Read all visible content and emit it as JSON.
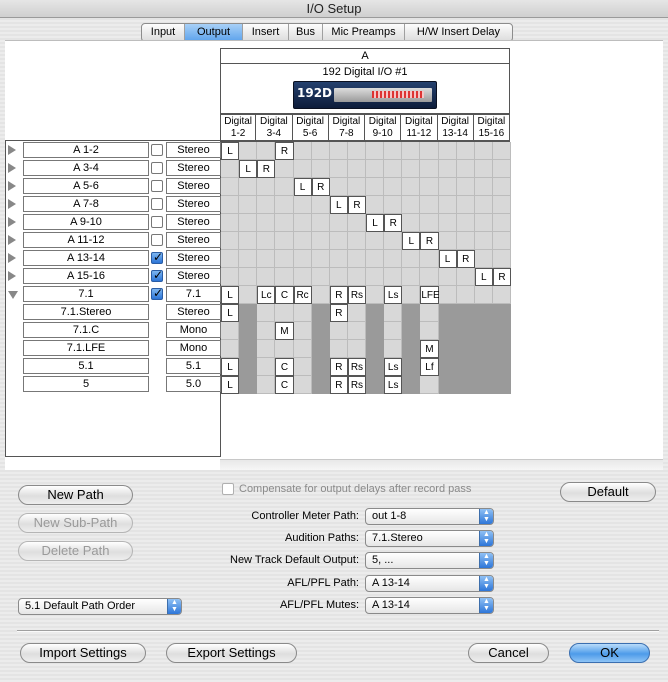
{
  "window": {
    "title": "I/O Setup"
  },
  "tabs": [
    {
      "label": "Input",
      "active": false
    },
    {
      "label": "Output",
      "active": true
    },
    {
      "label": "Insert",
      "active": false
    },
    {
      "label": "Bus",
      "active": false
    },
    {
      "label": "Mic Preamps",
      "active": false
    },
    {
      "label": "H/W Insert Delay",
      "active": false
    }
  ],
  "matrix": {
    "group": "A",
    "device": "192 Digital I/O #1",
    "device_logo": "192D",
    "columns": [
      {
        "top": "Digital",
        "bottom": "1-2"
      },
      {
        "top": "Digital",
        "bottom": "3-4"
      },
      {
        "top": "Digital",
        "bottom": "5-6"
      },
      {
        "top": "Digital",
        "bottom": "7-8"
      },
      {
        "top": "Digital",
        "bottom": "9-10"
      },
      {
        "top": "Digital",
        "bottom": "11-12"
      },
      {
        "top": "Digital",
        "bottom": "13-14"
      },
      {
        "top": "Digital",
        "bottom": "15-16"
      }
    ]
  },
  "paths": [
    {
      "name": "A 1-2",
      "expand": "right",
      "checked": false,
      "format": "Stereo",
      "marks": {
        "0": "L",
        "3": "R"
      }
    },
    {
      "name": "A 3-4",
      "expand": "right",
      "checked": false,
      "format": "Stereo",
      "marks": {
        "1": "L",
        "2": "R"
      }
    },
    {
      "name": "A 5-6",
      "expand": "right",
      "checked": false,
      "format": "Stereo",
      "marks": {
        "4": "L",
        "5": "R"
      }
    },
    {
      "name": "A 7-8",
      "expand": "right",
      "checked": false,
      "format": "Stereo",
      "marks": {
        "6": "L",
        "7": "R"
      }
    },
    {
      "name": "A 9-10",
      "expand": "right",
      "checked": false,
      "format": "Stereo",
      "marks": {
        "8": "L",
        "9": "R"
      }
    },
    {
      "name": "A 11-12",
      "expand": "right",
      "checked": false,
      "format": "Stereo",
      "marks": {
        "10": "L",
        "11": "R"
      }
    },
    {
      "name": "A 13-14",
      "expand": "right",
      "checked": true,
      "format": "Stereo",
      "marks": {
        "12": "L",
        "13": "R"
      }
    },
    {
      "name": "A 15-16",
      "expand": "right",
      "checked": true,
      "format": "Stereo",
      "marks": {
        "14": "L",
        "15": "R"
      }
    },
    {
      "name": "7.1",
      "expand": "down",
      "checked": true,
      "format": "7.1",
      "marks": {
        "0": "L",
        "2": "Lc",
        "3": "C",
        "4": "Rc",
        "6": "R",
        "7": "Rs",
        "9": "Ls",
        "11": "LFE"
      }
    },
    {
      "name": "7.1.Stereo",
      "expand": "none",
      "checked": null,
      "format": "Stereo",
      "marks": {
        "0": "L",
        "6": "R"
      },
      "sub": true
    },
    {
      "name": "7.1.C",
      "expand": "none",
      "checked": null,
      "format": "Mono",
      "marks": {
        "3": "M"
      },
      "sub": true
    },
    {
      "name": "7.1.LFE",
      "expand": "none",
      "checked": null,
      "format": "Mono",
      "marks": {
        "11": "M"
      },
      "sub": true
    },
    {
      "name": "5.1",
      "expand": "none",
      "checked": null,
      "format": "5.1",
      "marks": {
        "0": "L",
        "3": "C",
        "6": "R",
        "7": "Rs",
        "9": "Ls",
        "11": "Lf"
      },
      "sub": true
    },
    {
      "name": "5",
      "expand": "none",
      "checked": null,
      "format": "5.0",
      "marks": {
        "0": "L",
        "3": "C",
        "6": "R",
        "7": "Rs",
        "9": "Ls"
      },
      "sub": true
    }
  ],
  "buttons": {
    "new_path": "New Path",
    "new_sub_path": "New Sub-Path",
    "delete_path": "Delete Path",
    "default": "Default",
    "import": "Import Settings",
    "export": "Export Settings",
    "cancel": "Cancel",
    "ok": "OK"
  },
  "compensate": {
    "label": "Compensate for output delays after record pass",
    "checked": false
  },
  "settings": [
    {
      "label": "Controller Meter Path:",
      "value": "out 1-8"
    },
    {
      "label": "Audition Paths:",
      "value": "7.1.Stereo"
    },
    {
      "label": "New Track Default Output:",
      "value": "5, ..."
    },
    {
      "label": "AFL/PFL Path:",
      "value": "A 13-14"
    },
    {
      "label": "AFL/PFL Mutes:",
      "value": "A 13-14"
    }
  ],
  "path_order": {
    "value": "5.1 Default Path Order"
  },
  "colors": {
    "accent": "#4d9be9",
    "grid_gray": "#d8d8d8",
    "grid_dark": "#9a9a9a"
  }
}
